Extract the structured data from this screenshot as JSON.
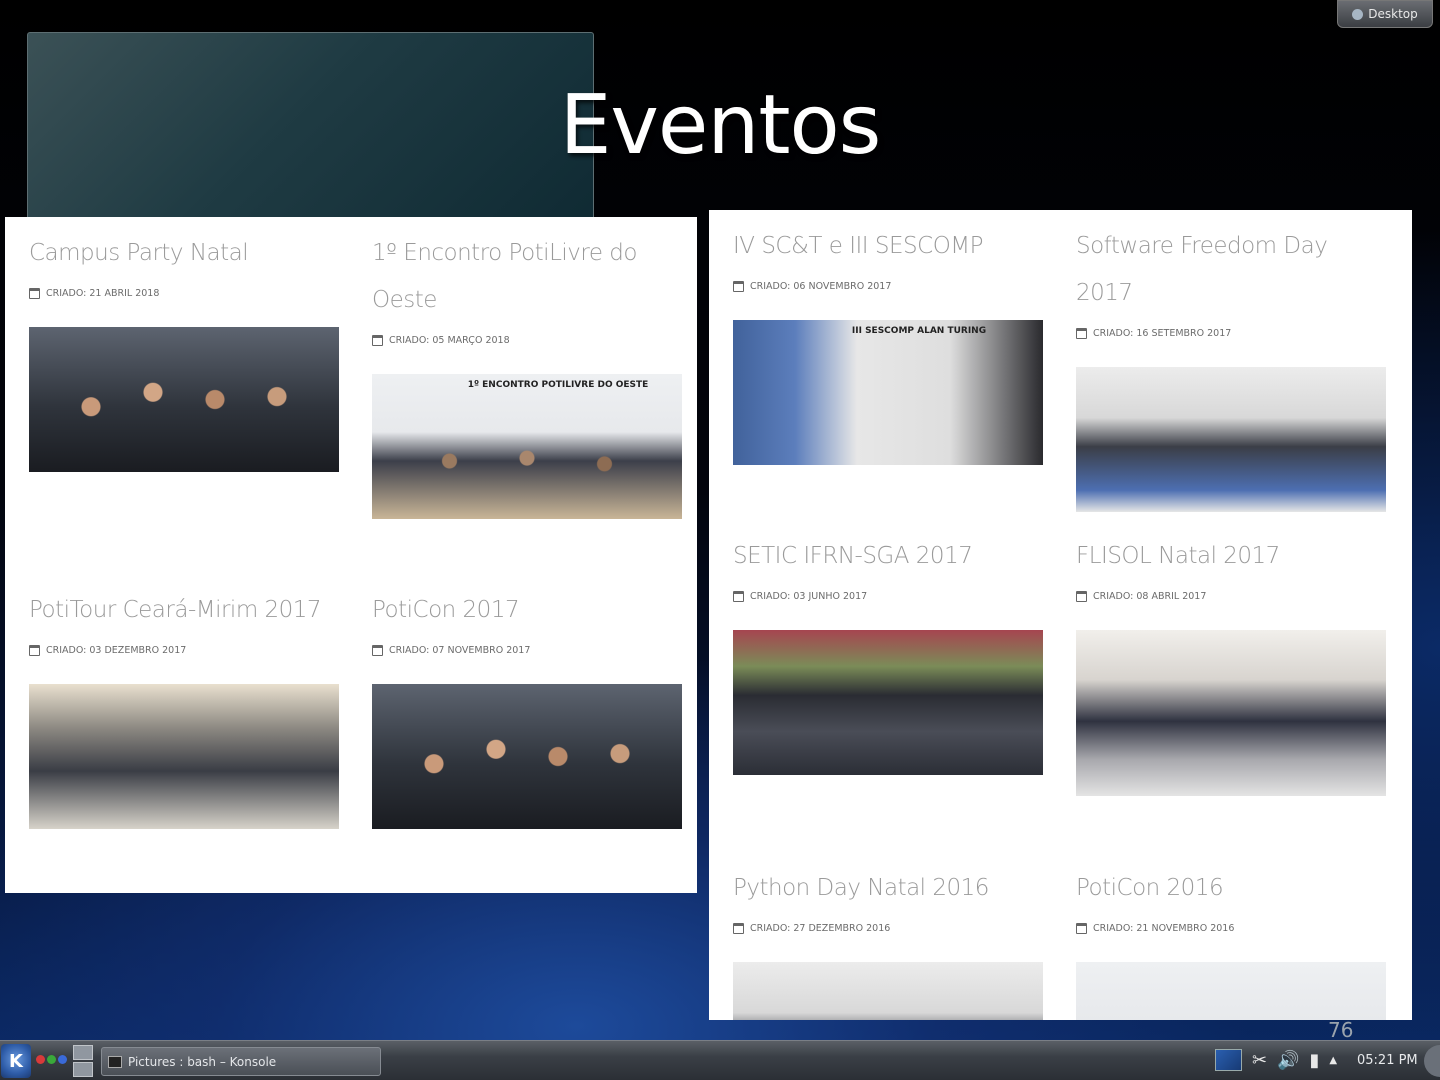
{
  "desktop_button": {
    "label": "Desktop"
  },
  "slide": {
    "title": "Eventos",
    "page_number": "76"
  },
  "left_panel": {
    "cards": [
      {
        "title": "Campus Party Natal",
        "meta": "CRIADO: 21 ABRIL 2018"
      },
      {
        "title": "1º Encontro PotiLivre do Oeste",
        "meta": "CRIADO: 05 MARÇO 2018",
        "photo_sign": "1º ENCONTRO POTILIVRE DO OESTE"
      },
      {
        "title": "PotiTour Ceará-Mirim 2017",
        "meta": "CRIADO: 03 DEZEMBRO 2017"
      },
      {
        "title": "PotiCon 2017",
        "meta": "CRIADO: 07 NOVEMBRO 2017"
      }
    ]
  },
  "right_panel": {
    "cards": [
      {
        "title": "IV SC&T e III SESCOMP",
        "meta": "CRIADO: 06 NOVEMBRO 2017",
        "photo_sign": "III SESCOMP  ALAN TURING"
      },
      {
        "title": "Software Freedom Day 2017",
        "meta": "CRIADO: 16 SETEMBRO 2017"
      },
      {
        "title": "SETIC IFRN-SGA 2017",
        "meta": "CRIADO: 03 JUNHO 2017"
      },
      {
        "title": "FLISOL Natal 2017",
        "meta": "CRIADO: 08 ABRIL 2017"
      },
      {
        "title": "Python Day Natal 2016",
        "meta": "CRIADO: 27 DEZEMBRO 2016"
      },
      {
        "title": "PotiCon 2016",
        "meta": "CRIADO: 21 NOVEMBRO 2016"
      }
    ]
  },
  "taskbar": {
    "task_label": "Pictures : bash – Konsole",
    "clock": "05:21 PM"
  }
}
